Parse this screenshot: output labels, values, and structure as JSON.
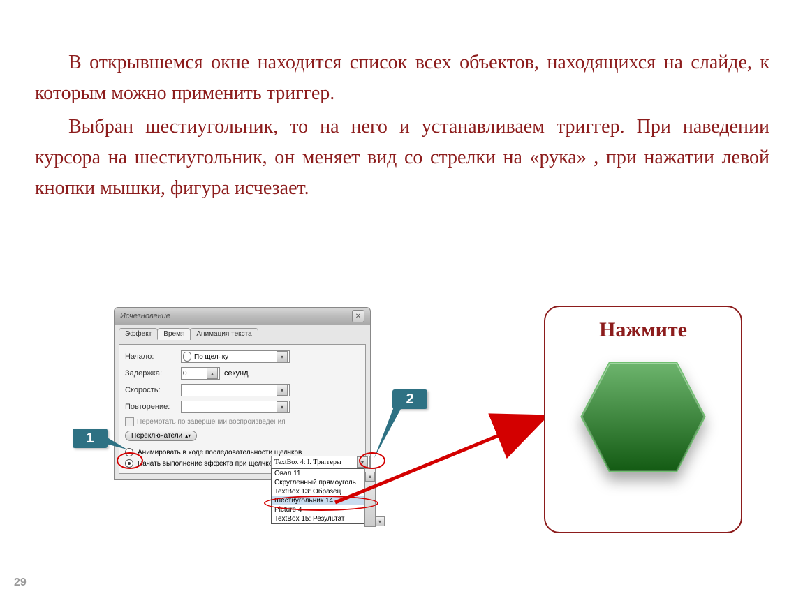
{
  "page_number": "29",
  "paragraphs": {
    "p1": "В открывшемся окне находится список всех объектов, находящихся на слайде, к которым можно применить триггер.",
    "p2": "Выбран шестиугольник, то на него и устанавливаем триггер. При наведении курсора на шестиугольник, он меняет вид со стрелки на «рука» , при нажатии левой кнопки мышки, фигура исчезает."
  },
  "dialog": {
    "title": "Исчезновение",
    "tabs": {
      "effect": "Эффект",
      "time": "Время",
      "anim": "Анимация текста"
    },
    "labels": {
      "start": "Начало:",
      "delay": "Задержка:",
      "speed": "Скорость:",
      "repeat": "Повторение:",
      "seconds": "секунд",
      "rewind": "Перемотать по завершении воспроизведения",
      "switchers": "Переключатели",
      "radio1": "Анимировать в ходе последовательности щелчков",
      "radio2": "Начать выполнение эффекта при щелчке"
    },
    "values": {
      "start_value": "По щелчку",
      "delay_value": "0",
      "trigger_selected": "TextBox 4: I. Триггеры"
    },
    "dropdown": {
      "item1": "Овал 11",
      "item2": "Скругленный прямоуголь",
      "item3": "TextBox 13: Образец",
      "item4": "Шестиугольник 14",
      "item5": "Picture 4",
      "item6": "TextBox 15: Результат"
    }
  },
  "callouts": {
    "one": "1",
    "two": "2"
  },
  "right_panel": {
    "title": "Нажмите"
  }
}
